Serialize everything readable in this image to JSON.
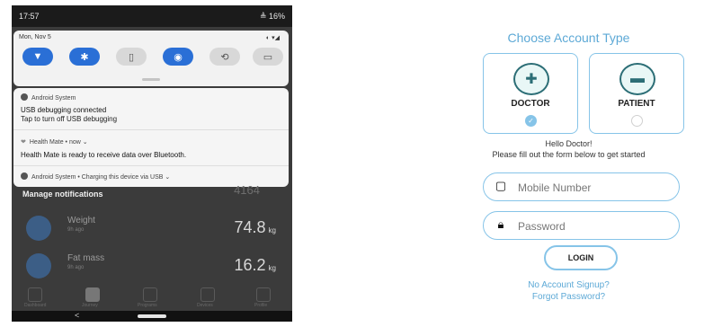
{
  "phone": {
    "status": {
      "time": "17:57",
      "battery": "≜ 16%"
    },
    "shade": {
      "date": "Mon, Nov 5",
      "toggles": [
        {
          "icon": "wifi-icon",
          "glyph": "▼",
          "active": true
        },
        {
          "icon": "bluetooth-icon",
          "glyph": "✱",
          "active": true
        },
        {
          "icon": "flashlight-icon",
          "glyph": "▯",
          "active": false
        },
        {
          "icon": "location-icon",
          "glyph": "◉",
          "active": true
        },
        {
          "icon": "rotate-icon",
          "glyph": "⟲",
          "active": false
        },
        {
          "icon": "battery-saver-icon",
          "glyph": "▭",
          "active": false
        }
      ]
    },
    "notifications": [
      {
        "app": "Android System",
        "title": "USB debugging connected",
        "text": "Tap to turn off USB debugging"
      },
      {
        "app": "Health Mate • now ⌄",
        "text": "Health Mate is ready to receive data over Bluetooth."
      },
      {
        "app": "Android System • Charging this device via USB ⌄"
      }
    ],
    "manage_label": "Manage notifications",
    "ghost_value": "4164",
    "metrics": [
      {
        "name": "Weight",
        "ago": "9h ago",
        "value": "74.8",
        "unit": "kg"
      },
      {
        "name": "Fat mass",
        "ago": "9h ago",
        "value": "16.2",
        "unit": "kg"
      }
    ],
    "nav": [
      {
        "label": "Dashboard"
      },
      {
        "label": "Journey"
      },
      {
        "label": "Programs"
      },
      {
        "label": "Devices"
      },
      {
        "label": "Profile"
      }
    ],
    "back_glyph": "<"
  },
  "login": {
    "heading": "Choose Account Type",
    "types": [
      {
        "label": "DOCTOR",
        "selected": true,
        "icon": "doctor-icon"
      },
      {
        "label": "PATIENT",
        "selected": false,
        "icon": "patient-bed-icon"
      }
    ],
    "greeting": "Hello Doctor!",
    "instructions": "Please fill out the form below to get started",
    "mobile_placeholder": "Mobile Number",
    "password_placeholder": "Password",
    "login_button": "LOGIN",
    "signup_link": "No Account Signup?",
    "forgot_link": "Forgot Password?",
    "accent_color": "#5da9d6",
    "border_color": "#86c4e8"
  }
}
